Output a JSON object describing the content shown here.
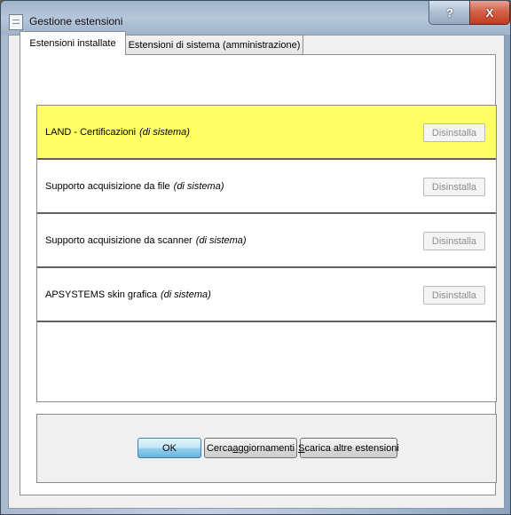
{
  "window": {
    "title": "Gestione estensioni",
    "help_label": "?",
    "close_label": "X"
  },
  "tabs": [
    {
      "label": "Estensioni installate",
      "active": true
    },
    {
      "label": "Estensioni di sistema (amministrazione)",
      "active": false
    }
  ],
  "extensions": [
    {
      "name": "LAND - Certificazioni",
      "tag": "(di sistema)",
      "button": "Disinstalla",
      "selected": true,
      "button_enabled": false
    },
    {
      "name": "Supporto acquisizione da file",
      "tag": "(di sistema)",
      "button": "Disinstalla",
      "selected": false,
      "button_enabled": false
    },
    {
      "name": "Supporto acquisizione da scanner",
      "tag": "(di sistema)",
      "button": "Disinstalla",
      "selected": false,
      "button_enabled": false
    },
    {
      "name": "APSYSTEMS skin grafica",
      "tag": "(di sistema)",
      "button": "Disinstalla",
      "selected": false,
      "button_enabled": false
    }
  ],
  "buttons": {
    "ok": "OK",
    "check_updates_pre": "Cerca ",
    "check_updates_key": "a",
    "check_updates_post": "ggiornamenti",
    "download_key": "S",
    "download_post": "carica altre estensioni"
  },
  "colors": {
    "selected_row": "#ffff66",
    "close_button": "#c8452b",
    "ok_button": "#98d1ef"
  }
}
